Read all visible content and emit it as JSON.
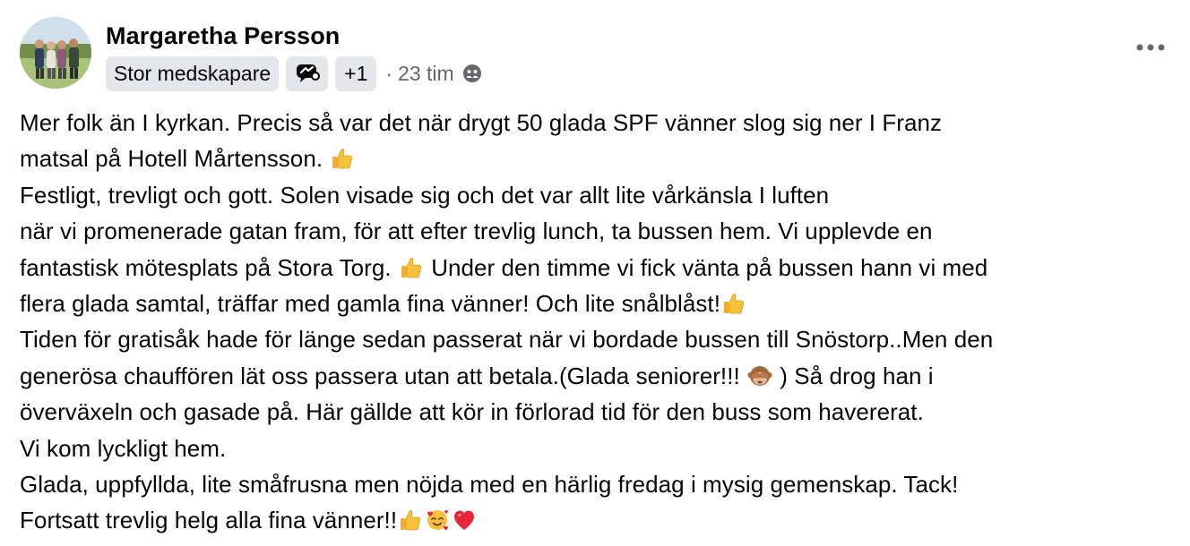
{
  "post": {
    "author": {
      "name": "Margaretha Persson"
    },
    "badge_label": "Stor medskapare",
    "extra_count": "+1",
    "separator": "·",
    "timestamp": "23 tim",
    "audience_icon": "group-icon",
    "more_icon": "ellipsis-icon",
    "lines": [
      [
        "Mer folk än I kyrkan. Precis så var det när drygt 50 glada SPF vänner slog sig ner I Franz"
      ],
      [
        "matsal på Hotell Mårtensson. "
      ],
      [
        "Festligt, trevligt och gott. Solen visade sig och det var allt lite vårkänsla I luften"
      ],
      [
        "när vi promenerade gatan fram, för att efter trevlig lunch, ta bussen hem. Vi upplevde en"
      ],
      [
        "fantastisk mötesplats på Stora Torg. ",
        " Under den timme vi fick vänta på bussen hann vi med"
      ],
      [
        "flera glada samtal, träffar med gamla fina vänner! Och lite snålblåst!"
      ],
      [
        "Tiden för gratisåk hade för länge sedan passerat när vi bordade bussen till Snöstorp..Men den"
      ],
      [
        "generösa chauffören lät oss passera utan att betala.(Glada seniorer!!! ",
        " ) Så drog han i"
      ],
      [
        "överväxeln och gasade på. Här gällde att kör in förlorad tid för den buss som havererat."
      ],
      [
        "Vi kom lyckligt hem."
      ],
      [
        "Glada, uppfyllda, lite småfrusna men nöjda med en härlig fredag i mysig gemenskap. Tack!"
      ],
      [
        " Fortsatt trevlig helg alla fina vänner!!"
      ]
    ],
    "emojis": {
      "thumbs_up": "thumbs-up-emoji",
      "see_no_evil": "see-no-evil-monkey-emoji",
      "smiling_hearts": "smiling-face-with-hearts-emoji",
      "heart": "red-heart-emoji"
    },
    "colors": {
      "text": "#050505",
      "secondary_text": "#65676b",
      "chip_bg": "#e4e6eb",
      "emoji_yellow": "#f7c13a",
      "heart_red": "#e8263a"
    }
  }
}
